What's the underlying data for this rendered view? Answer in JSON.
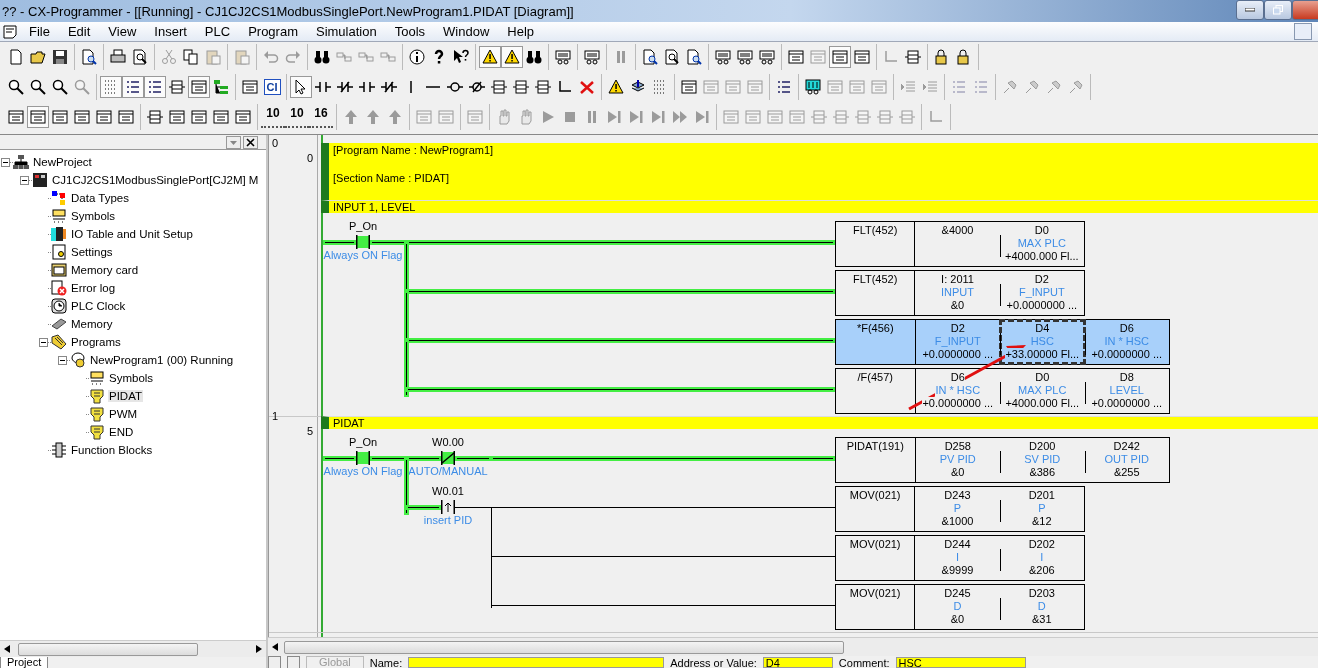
{
  "window": {
    "title": "?? - CX-Programmer - [[Running] - CJ1CJ2CS1ModbusSinglePort.NewProgram1.PIDAT [Diagram]]"
  },
  "menu": [
    "File",
    "Edit",
    "View",
    "Insert",
    "PLC",
    "Program",
    "Simulation",
    "Tools",
    "Window",
    "Help"
  ],
  "toolbar_text_buttons": [
    "CI",
    "10",
    "10",
    "16"
  ],
  "project_tree": [
    {
      "label": "NewProject",
      "kind": "project",
      "expanded": true,
      "selected": false,
      "children": [
        {
          "label": "CJ1CJ2CS1ModbusSinglePort[CJ2M] M",
          "kind": "plc",
          "expanded": true,
          "selected": false,
          "children": [
            {
              "label": "Data Types",
              "kind": "datatypes",
              "selected": false
            },
            {
              "label": "Symbols",
              "kind": "symbols",
              "selected": false
            },
            {
              "label": "IO Table and Unit Setup",
              "kind": "io",
              "selected": false
            },
            {
              "label": "Settings",
              "kind": "settings",
              "selected": false
            },
            {
              "label": "Memory card",
              "kind": "memcard",
              "selected": false
            },
            {
              "label": "Error log",
              "kind": "errorlog",
              "selected": false
            },
            {
              "label": "PLC Clock",
              "kind": "clock",
              "selected": false
            },
            {
              "label": "Memory",
              "kind": "memory",
              "selected": false
            },
            {
              "label": "Programs",
              "kind": "programs",
              "expanded": true,
              "selected": false,
              "children": [
                {
                  "label": "NewProgram1 (00) Running",
                  "kind": "program",
                  "expanded": true,
                  "selected": false,
                  "children": [
                    {
                      "label": "Symbols",
                      "kind": "symbols",
                      "selected": false
                    },
                    {
                      "label": "PIDAT",
                      "kind": "section",
                      "selected": true
                    },
                    {
                      "label": "PWM",
                      "kind": "section",
                      "selected": false
                    },
                    {
                      "label": "END",
                      "kind": "section",
                      "selected": false
                    }
                  ]
                }
              ]
            },
            {
              "label": "Function Blocks",
              "kind": "fb",
              "selected": false
            }
          ]
        }
      ]
    }
  ],
  "project_tab": "Project",
  "diagram": {
    "rungs": [
      {
        "number": "0",
        "step": "0",
        "comments": [
          "[Program Name : NewProgram1]",
          "[Section Name : PIDAT]"
        ],
        "title": "INPUT 1, LEVEL",
        "rows": [
          {
            "contacts": [
              {
                "kind": "no",
                "address": "P_On",
                "symbol": "Always ON Flag",
                "on": true
              }
            ],
            "instruction": {
              "mnemonic": "FLT(452)",
              "selected": false,
              "operands": [
                {
                  "address": "&4000",
                  "focused": false
                },
                {
                  "address": "D0",
                  "symbol": "MAX PLC",
                  "value": "+4000.000 Fl...",
                  "focused": false
                }
              ]
            }
          },
          {
            "contacts": [],
            "instruction": {
              "mnemonic": "FLT(452)",
              "selected": false,
              "operands": [
                {
                  "address": "I: 2011",
                  "symbol": "INPUT",
                  "value": "&0",
                  "focused": false
                },
                {
                  "address": "D2",
                  "symbol": "F_INPUT",
                  "value": "+0.0000000 ...",
                  "focused": false
                }
              ]
            }
          },
          {
            "contacts": [],
            "instruction": {
              "mnemonic": "*F(456)",
              "selected": true,
              "operands": [
                {
                  "address": "D2",
                  "symbol": "F_INPUT",
                  "value": "+0.0000000 ...",
                  "focused": false
                },
                {
                  "address": "D4",
                  "symbol": "HSC",
                  "value": "+33.00000 Fl...",
                  "focused": true
                },
                {
                  "address": "D6",
                  "symbol": "IN * HSC",
                  "value": "+0.0000000 ...",
                  "focused": false
                }
              ]
            }
          },
          {
            "contacts": [],
            "instruction": {
              "mnemonic": "/F(457)",
              "selected": false,
              "operands": [
                {
                  "address": "D6",
                  "symbol": "IN * HSC",
                  "value": "+0.0000000 ...",
                  "focused": false
                },
                {
                  "address": "D0",
                  "symbol": "MAX PLC",
                  "value": "+4000.000 Fl...",
                  "focused": false
                },
                {
                  "address": "D8",
                  "symbol": "LEVEL",
                  "value": "+0.0000000 ...",
                  "focused": false
                }
              ]
            }
          }
        ]
      },
      {
        "number": "1",
        "step": "5",
        "title": "PIDAT",
        "rows": [
          {
            "contacts": [
              {
                "kind": "no",
                "address": "P_On",
                "symbol": "Always ON Flag",
                "on": true
              },
              {
                "kind": "nc",
                "address": "W0.00",
                "symbol": "AUTO/MANUAL",
                "on": true
              }
            ],
            "instruction": {
              "mnemonic": "PIDAT(191)",
              "selected": false,
              "operands": [
                {
                  "address": "D258",
                  "symbol": "PV PID",
                  "value": "&0",
                  "focused": false
                },
                {
                  "address": "D200",
                  "symbol": "SV PID",
                  "value": "&386",
                  "focused": false
                },
                {
                  "address": "D242",
                  "symbol": "OUT PID",
                  "value": "&255",
                  "focused": false
                }
              ]
            }
          },
          {
            "contacts": [
              {
                "kind": "rising",
                "address": "W0.01",
                "symbol": "insert PID",
                "on": false
              }
            ],
            "instruction": {
              "mnemonic": "MOV(021)",
              "selected": false,
              "operands": [
                {
                  "address": "D243",
                  "symbol": "P",
                  "value": "&1000",
                  "focused": false
                },
                {
                  "address": "D201",
                  "symbol": "P",
                  "value": "&12",
                  "focused": false
                }
              ]
            }
          },
          {
            "contacts": [],
            "instruction": {
              "mnemonic": "MOV(021)",
              "selected": false,
              "operands": [
                {
                  "address": "D244",
                  "symbol": "I",
                  "value": "&9999",
                  "focused": false
                },
                {
                  "address": "D202",
                  "symbol": "I",
                  "value": "&206",
                  "focused": false
                }
              ]
            }
          },
          {
            "contacts": [],
            "instruction": {
              "mnemonic": "MOV(021)",
              "selected": false,
              "operands": [
                {
                  "address": "D245",
                  "symbol": "D",
                  "value": "&0",
                  "focused": false
                },
                {
                  "address": "D203",
                  "symbol": "D",
                  "value": "&31",
                  "focused": false
                }
              ]
            }
          }
        ]
      }
    ]
  },
  "status_bar": {
    "tab": "Global",
    "name_label": "Name:",
    "address_label": "Address or Value:",
    "address_value": "D4",
    "comment_label": "Comment:",
    "comment_value": "HSC"
  }
}
